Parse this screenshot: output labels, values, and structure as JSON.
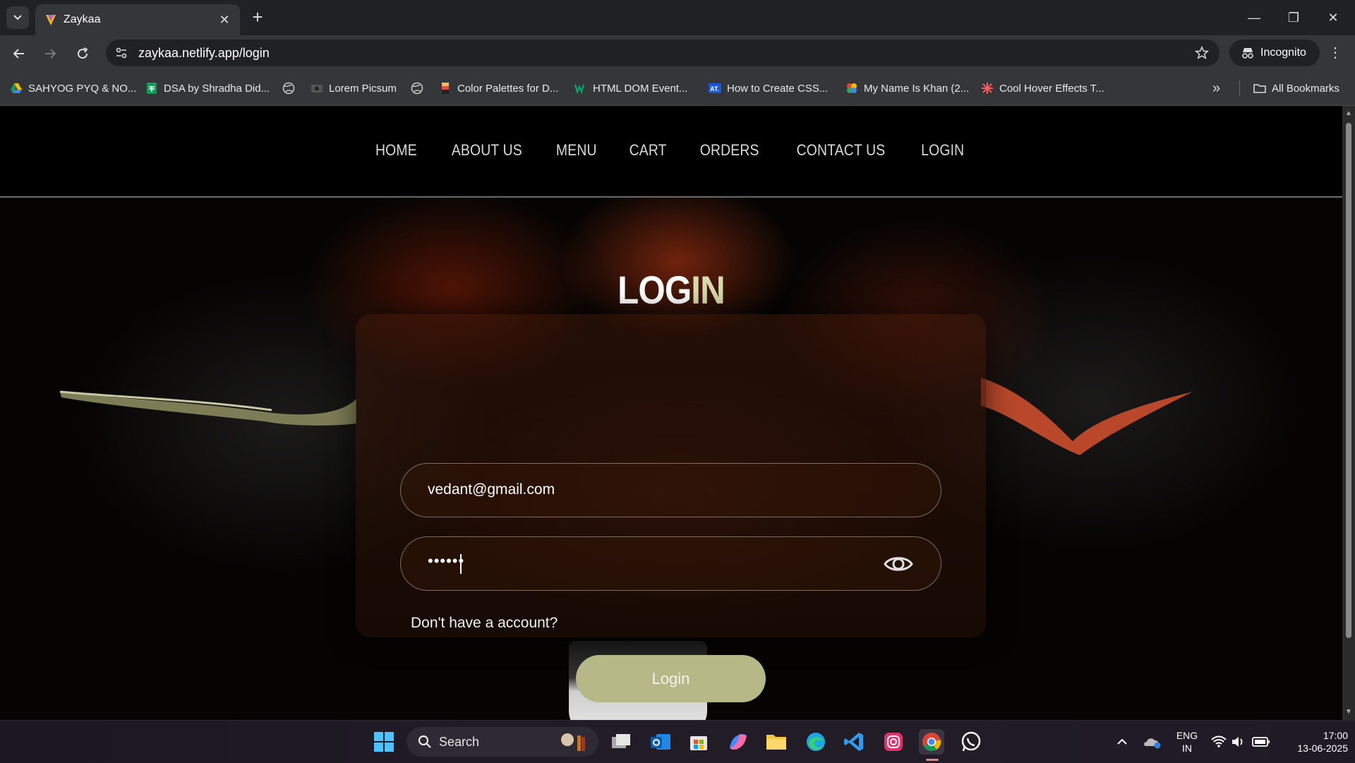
{
  "browser": {
    "tab_title": "Zaykaa",
    "url": "zaykaa.netlify.app/login",
    "incognito_label": "Incognito",
    "all_bookmarks_label": "All Bookmarks"
  },
  "bookmarks": [
    {
      "label": "SAHYOG PYQ & NO...",
      "icon": "drive-icon"
    },
    {
      "label": "DSA by Shradha Did...",
      "icon": "sheets-icon"
    },
    {
      "label": "",
      "icon": "globe-icon"
    },
    {
      "label": "Lorem Picsum",
      "icon": "picsum-icon"
    },
    {
      "label": "",
      "icon": "globe-icon"
    },
    {
      "label": "Color Palettes for D...",
      "icon": "palette-icon"
    },
    {
      "label": "HTML DOM Event...",
      "icon": "w3-icon"
    },
    {
      "label": "How to Create CSS...",
      "icon": "at-icon"
    },
    {
      "label": "My Name Is Khan (2...",
      "icon": "movie-icon"
    },
    {
      "label": "Cool Hover Effects T...",
      "icon": "star-burst-icon"
    }
  ],
  "nav": {
    "links": [
      "HOME",
      "ABOUT US",
      "MENU",
      "CART",
      "ORDERS",
      "CONTACT US",
      "LOGIN"
    ]
  },
  "login": {
    "title_main": "LOG",
    "title_highlight": "IN",
    "email_value": "vedant@gmail.com",
    "password_mask": "••••••",
    "signup_text": "Don't have a account?",
    "button_label": "Login"
  },
  "taskbar": {
    "search_label": "Search",
    "language": "ENG",
    "region": "IN",
    "time": "17:00",
    "date": "13-06-2025"
  },
  "colors": {
    "accent_title": "#d9dcaa",
    "login_button": "#b6b887"
  }
}
